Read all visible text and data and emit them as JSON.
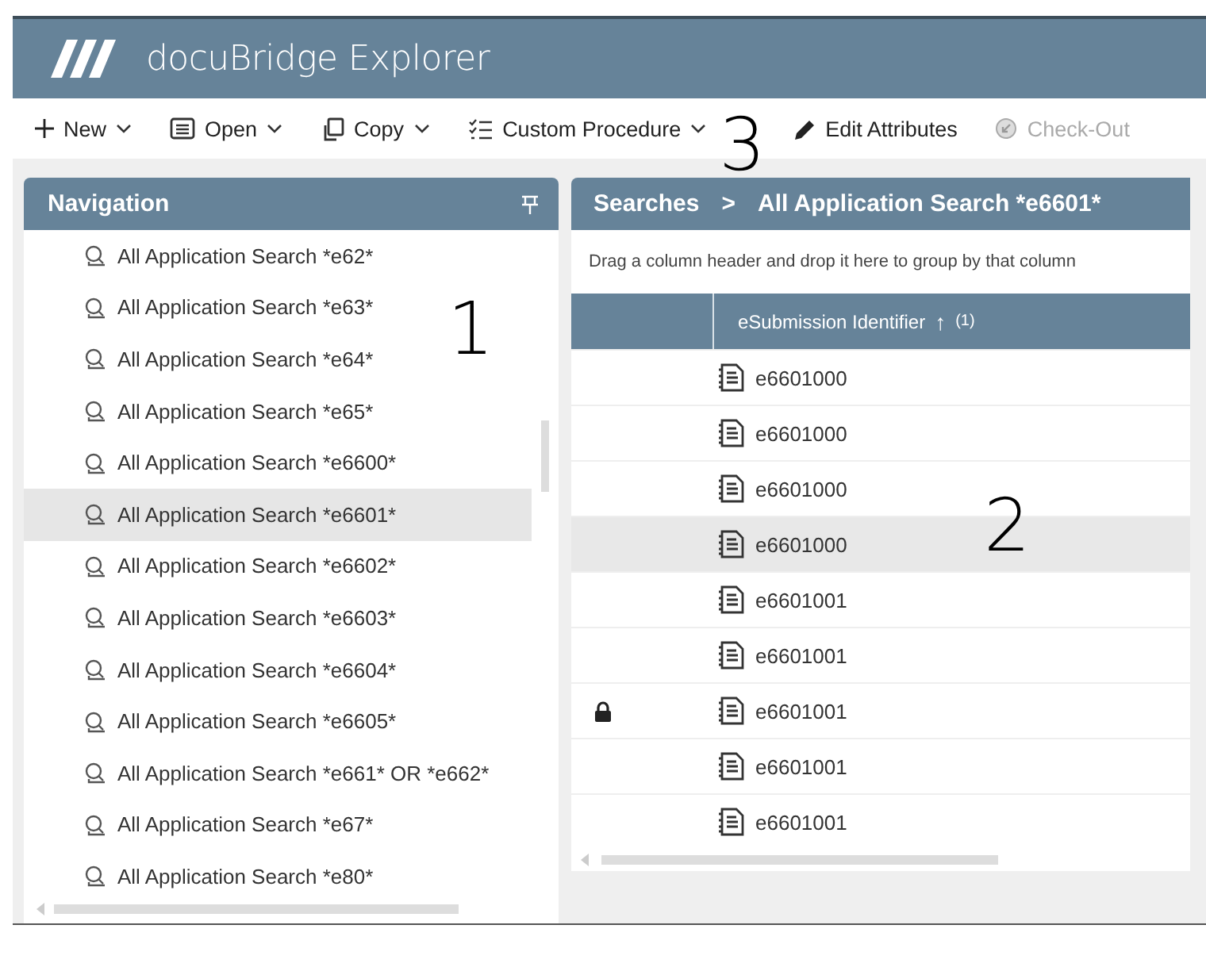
{
  "window": {
    "title": "docuBridge Explorer"
  },
  "toolbar": [
    {
      "kind": "new",
      "label": "New",
      "dropdown": true,
      "disabled": false
    },
    {
      "kind": "open",
      "label": "Open",
      "dropdown": true,
      "disabled": false
    },
    {
      "kind": "copy",
      "label": "Copy",
      "dropdown": true,
      "disabled": false
    },
    {
      "kind": "procedure",
      "label": "Custom Procedure",
      "dropdown": true,
      "disabled": false
    },
    {
      "kind": "edit",
      "label": "Edit Attributes",
      "dropdown": false,
      "disabled": false
    },
    {
      "kind": "checkout",
      "label": "Check-Out",
      "dropdown": false,
      "disabled": true
    }
  ],
  "navigation": {
    "title": "Navigation",
    "items": [
      {
        "label": "All Application Search *e62*",
        "selected": false
      },
      {
        "label": "All Application Search *e63*",
        "selected": false
      },
      {
        "label": "All Application Search *e64*",
        "selected": false
      },
      {
        "label": "All Application Search *e65*",
        "selected": false
      },
      {
        "label": "All Application Search *e6600*",
        "selected": false
      },
      {
        "label": "All Application Search *e6601*",
        "selected": true
      },
      {
        "label": "All Application Search *e6602*",
        "selected": false
      },
      {
        "label": "All Application Search *e6603*",
        "selected": false
      },
      {
        "label": "All Application Search *e6604*",
        "selected": false
      },
      {
        "label": "All Application Search *e6605*",
        "selected": false
      },
      {
        "label": "All Application Search *e661* OR *e662*",
        "selected": false
      },
      {
        "label": "All Application Search *e67*",
        "selected": false
      },
      {
        "label": "All Application Search *e80*",
        "selected": false
      }
    ]
  },
  "breadcrumb": [
    "Searches",
    ">",
    "All Application Search *e6601*"
  ],
  "group_hint": "Drag a column header and drop it here to group by that column",
  "table": {
    "columns": [
      {
        "label": "eSubmission Identifier",
        "sort": "↑",
        "sort_order": "(1)"
      }
    ],
    "rows": [
      {
        "identifier": "e6601000",
        "locked": false,
        "selected": false
      },
      {
        "identifier": "e6601000",
        "locked": false,
        "selected": false
      },
      {
        "identifier": "e6601000",
        "locked": false,
        "selected": false
      },
      {
        "identifier": "e6601000",
        "locked": false,
        "selected": true
      },
      {
        "identifier": "e6601001",
        "locked": false,
        "selected": false
      },
      {
        "identifier": "e6601001",
        "locked": false,
        "selected": false
      },
      {
        "identifier": "e6601001",
        "locked": true,
        "selected": false
      },
      {
        "identifier": "e6601001",
        "locked": false,
        "selected": false
      },
      {
        "identifier": "e6601001",
        "locked": false,
        "selected": false
      }
    ]
  },
  "annotations": [
    "1",
    "2",
    "3"
  ]
}
